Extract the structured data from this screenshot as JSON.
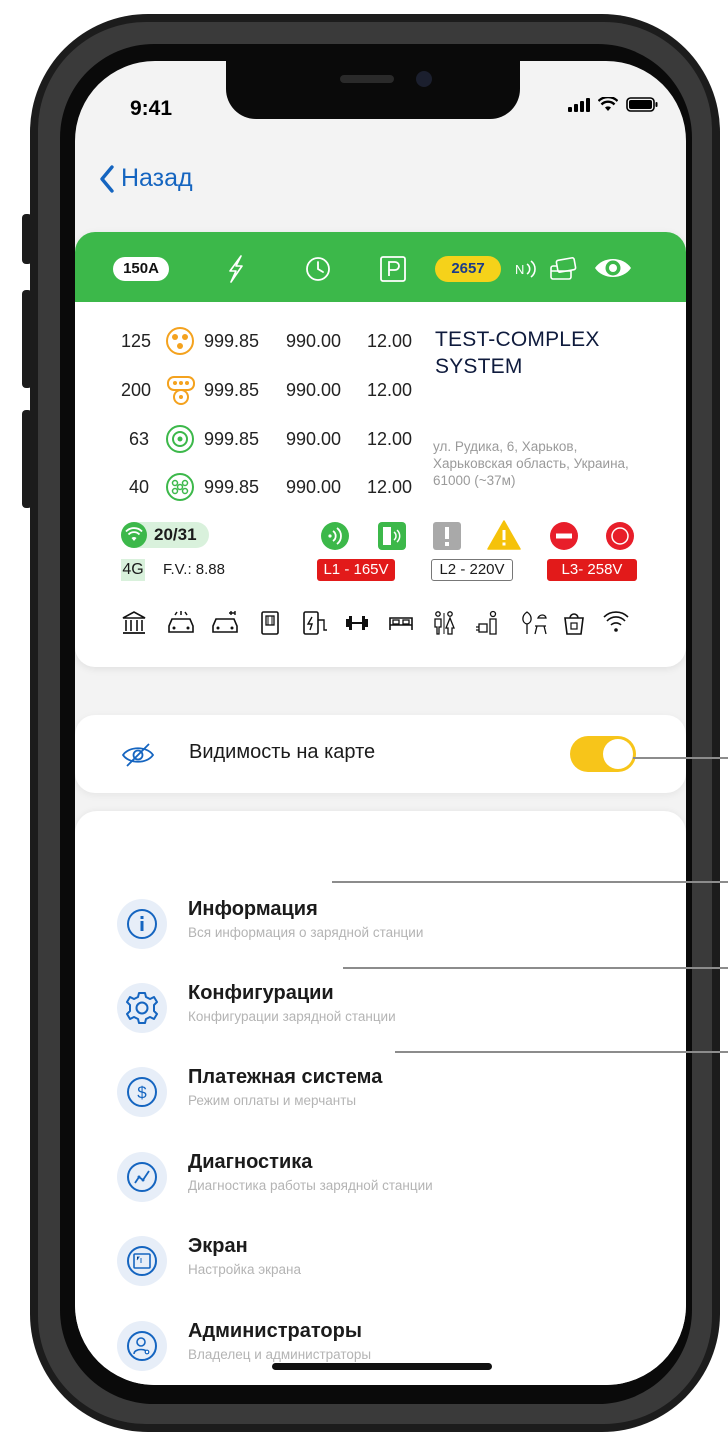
{
  "status_bar": {
    "time": "9:41"
  },
  "nav": {
    "back_label": "Назад"
  },
  "station": {
    "header": {
      "current_badge": "150A",
      "station_id_badge": "2657"
    },
    "connectors": [
      {
        "power": "125",
        "v1": "999.85",
        "v2": "990.00",
        "v3": "12.00",
        "icon": "ccs-connector-icon"
      },
      {
        "power": "200",
        "v1": "999.85",
        "v2": "990.00",
        "v3": "12.00",
        "icon": "multi-connector-icon"
      },
      {
        "power": "63",
        "v1": "999.85",
        "v2": "990.00",
        "v3": "12.00",
        "icon": "type2-connector-icon"
      },
      {
        "power": "40",
        "v1": "999.85",
        "v2": "990.00",
        "v3": "12.00",
        "icon": "gbt-connector-icon"
      }
    ],
    "name": "TEST-COMPLEX SYSTEM",
    "address": "ул. Рудика, 6, Харьков, Харьковская область, Украина, 61000 (~37м)",
    "wifi_count": "20/31",
    "network": "4G",
    "firmware": "F.V.: 8.88",
    "phases": [
      "L1 - 165V",
      "L2 - 220V",
      "L3- 258V"
    ],
    "colors": {
      "header": "#3cb84a",
      "badge_yellow": "#f5d21a",
      "phase_red": "#e21a1a",
      "warning": "#f5c20a",
      "stop_red": "#e81e2a"
    }
  },
  "visibility": {
    "label": "Видимость на карте",
    "enabled": true
  },
  "menu": [
    {
      "title": "Информация",
      "subtitle": "Вся информация о зарядной станции",
      "icon": "info-icon"
    },
    {
      "title": "Конфигурации",
      "subtitle": "Конфигурации зарядной станции",
      "icon": "gear-icon"
    },
    {
      "title": "Платежная система",
      "subtitle": "Режим оплаты и мерчанты",
      "icon": "dollar-icon"
    },
    {
      "title": "Диагностика",
      "subtitle": "Диагностика работы зарядной станции",
      "icon": "chart-icon"
    },
    {
      "title": "Экран",
      "subtitle": "Настройка экрана",
      "icon": "screen-icon"
    },
    {
      "title": "Администраторы",
      "subtitle": "Владелец и администраторы",
      "icon": "admins-icon"
    }
  ]
}
